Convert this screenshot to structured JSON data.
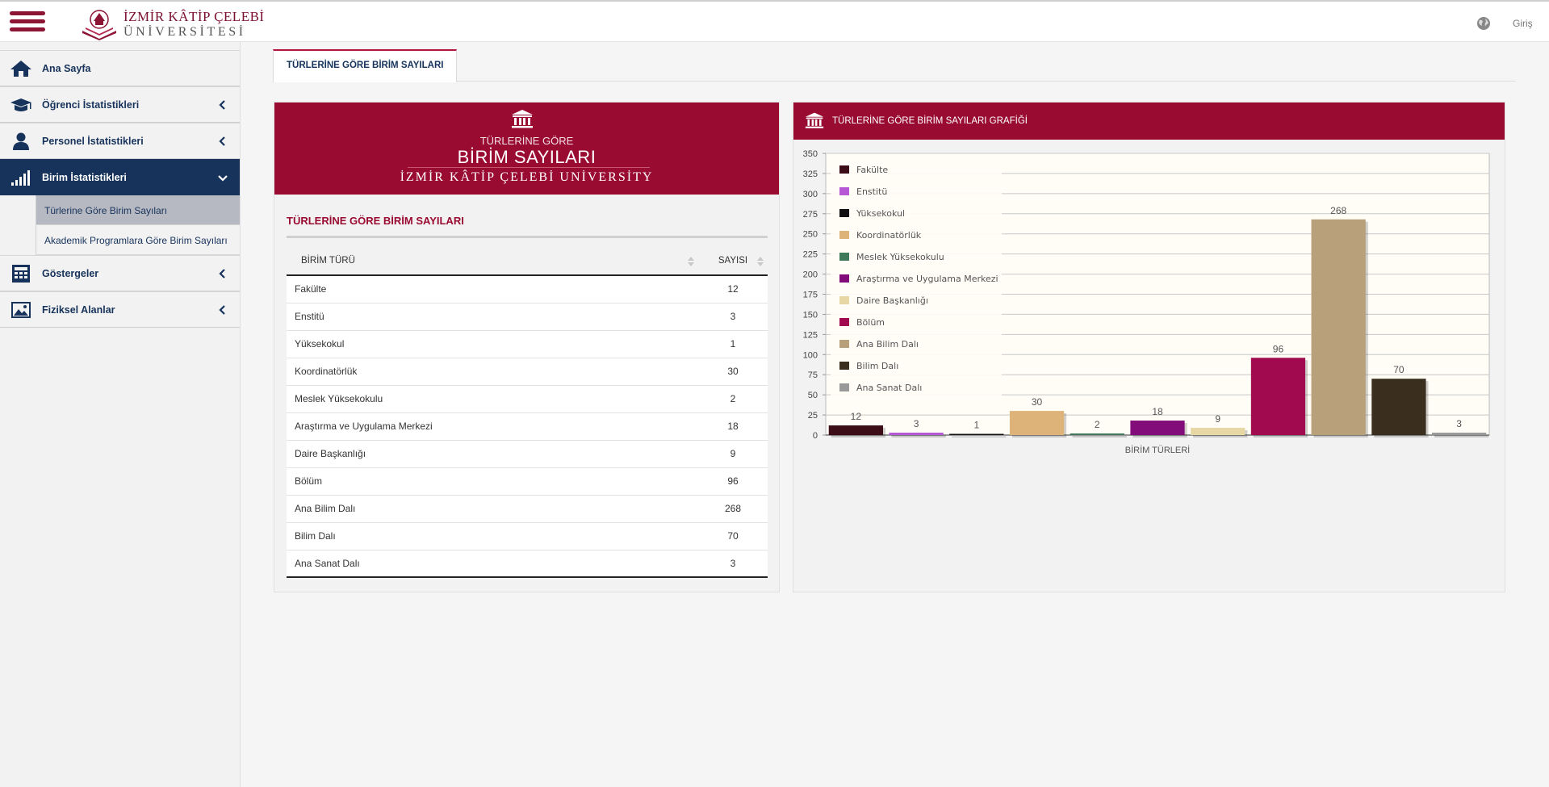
{
  "header": {
    "logo_line1": "İZMİR KÂTİP ÇELEBİ",
    "logo_line2": "ÜNİVERSİTESİ",
    "login_label": "Giriş"
  },
  "sidebar": {
    "items": [
      {
        "label": "Ana Sayfa",
        "icon": "home-icon"
      },
      {
        "label": "Öğrenci İstatistikleri",
        "icon": "graduation-cap-icon"
      },
      {
        "label": "Personel İstatistikleri",
        "icon": "user-icon"
      },
      {
        "label": "Birim İstatistikleri",
        "icon": "signal-bars-icon"
      },
      {
        "label": "Göstergeler",
        "icon": "calculator-icon"
      },
      {
        "label": "Fiziksel Alanlar",
        "icon": "picture-icon"
      }
    ],
    "subitems": [
      {
        "label": "Türlerine Göre Birim Sayıları"
      },
      {
        "label": "Akademik Programlara Göre Birim Sayıları"
      }
    ]
  },
  "tabs": [
    {
      "label": "TÜRLERİNE GÖRE BİRİM SAYILARI"
    }
  ],
  "summary": {
    "subtitle": "TÜRLERİNE GÖRE",
    "title": "BİRİM SAYILARI",
    "university": "İZMİR KÂTİP ÇELEBİ UNİVERSİTY",
    "icon": "institution-icon"
  },
  "table": {
    "title": "TÜRLERİNE GÖRE BİRİM SAYILARI",
    "columns": [
      "BİRİM TÜRÜ",
      "SAYISI"
    ],
    "rows": [
      [
        "Fakülte",
        "12"
      ],
      [
        "Enstitü",
        "3"
      ],
      [
        "Yüksekokul",
        "1"
      ],
      [
        "Koordinatörlük",
        "30"
      ],
      [
        "Meslek Yüksekokulu",
        "2"
      ],
      [
        "Araştırma ve Uygulama Merkezi",
        "18"
      ],
      [
        "Daire Başkanlığı",
        "9"
      ],
      [
        "Bölüm",
        "96"
      ],
      [
        "Ana Bilim Dalı",
        "268"
      ],
      [
        "Bilim Dalı",
        "70"
      ],
      [
        "Ana Sanat Dalı",
        "3"
      ]
    ]
  },
  "chart_panel": {
    "title": "TÜRLERİNE GÖRE BİRİM SAYILARI GRAFİĞİ",
    "icon": "institution-icon"
  },
  "chart_data": {
    "type": "bar",
    "title": "",
    "xlabel": "BİRİM TÜRLERİ",
    "ylabel": "",
    "ylim": [
      0,
      350
    ],
    "yticks": [
      0,
      25,
      50,
      75,
      100,
      125,
      150,
      175,
      200,
      225,
      250,
      275,
      300,
      325,
      350
    ],
    "grid": true,
    "legend_position": "top-left",
    "series": [
      {
        "name": "Fakülte",
        "value": 12,
        "color": "#3d0d17"
      },
      {
        "name": "Enstitü",
        "value": 3,
        "color": "#b657d6"
      },
      {
        "name": "Yüksekokul",
        "value": 1,
        "color": "#111111"
      },
      {
        "name": "Koordinatörlük",
        "value": 30,
        "color": "#ddb37a"
      },
      {
        "name": "Meslek Yüksekokulu",
        "value": 2,
        "color": "#3f7a5a"
      },
      {
        "name": "Araştırma ve Uygulama Merkezi",
        "value": 18,
        "color": "#820d7a"
      },
      {
        "name": "Daire Başkanlığı",
        "value": 9,
        "color": "#e7d7a4"
      },
      {
        "name": "Bölüm",
        "value": 96,
        "color": "#a10a4e"
      },
      {
        "name": "Ana Bilim Dalı",
        "value": 268,
        "color": "#b7a07a"
      },
      {
        "name": "Bilim Dalı",
        "value": 70,
        "color": "#3a2f1f"
      },
      {
        "name": "Ana Sanat Dalı",
        "value": 3,
        "color": "#999999"
      }
    ]
  }
}
